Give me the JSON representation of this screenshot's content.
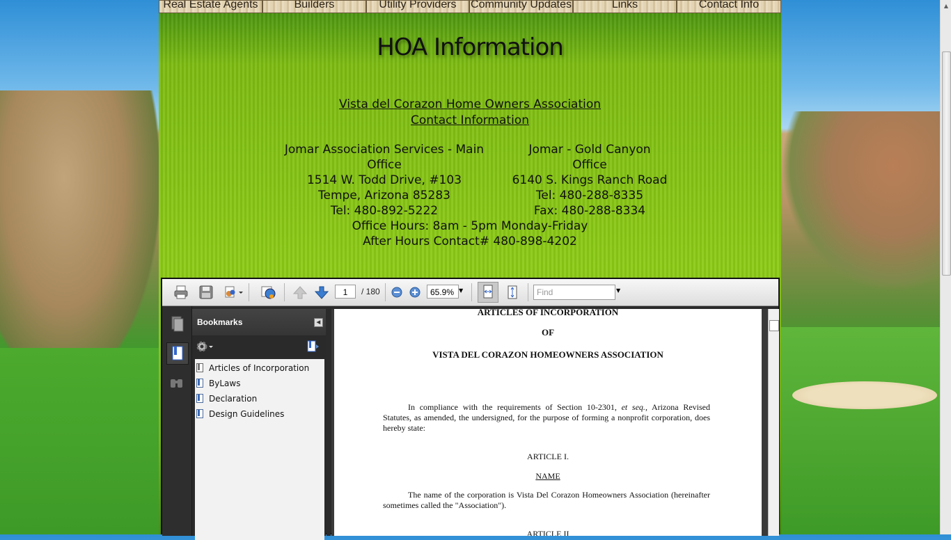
{
  "nav": {
    "items": [
      "Real Estate Agents",
      "Builders",
      "Utility Providers",
      "Community Updates",
      "Links",
      "Contact Info"
    ]
  },
  "hoa": {
    "title": "HOA Information",
    "association_link": "Vista del Corazon Home Owners Association",
    "contact_link": "Contact Information",
    "main_office": {
      "name": "Jomar Association Services - Main Office",
      "street": "1514 W. Todd Drive, #103",
      "city": "Tempe, Arizona 85283",
      "tel": "Tel: 480-892-5222"
    },
    "gc_office": {
      "name": "Jomar - Gold Canyon Office",
      "street": "6140 S. Kings Ranch Road",
      "tel": "Tel: 480-288-8335",
      "fax": "Fax: 480-288-8334"
    },
    "hours": "Office Hours: 8am - 5pm Monday-Friday",
    "after_hours": "After Hours Contact# 480-898-4202"
  },
  "pdf": {
    "current_page": "1",
    "total_pages": "/ 180",
    "zoom": "65.9%",
    "find_placeholder": "Find",
    "bookmarks_title": "Bookmarks",
    "bookmarks": [
      "Articles of Incorporation",
      "ByLaws",
      "Declaration",
      "Design Guidelines"
    ],
    "document": {
      "title_line1": "ARTICLES OF INCORPORATION",
      "title_line2": "OF",
      "title_line3": "VISTA DEL CORAZON HOMEOWNERS ASSOCIATION",
      "para1_a": "In compliance with the requirements of Section 10-2301, ",
      "para1_em": "et seq.",
      "para1_b": ", Arizona Revised Statutes, as amended, the undersigned, for the purpose of forming a nonprofit corporation, does hereby state:",
      "article1": "ARTICLE I.",
      "article1_heading": "NAME",
      "para2": "The name of the corporation is Vista Del Corazon Homeowners Association (hereinafter sometimes called the \"Association\").",
      "article2": "ARTICLE II"
    }
  },
  "colors": {
    "page_green": "#8ccb16",
    "pdf_dark": "#2b2b2b",
    "nav_wood": "#e3d4b4"
  }
}
